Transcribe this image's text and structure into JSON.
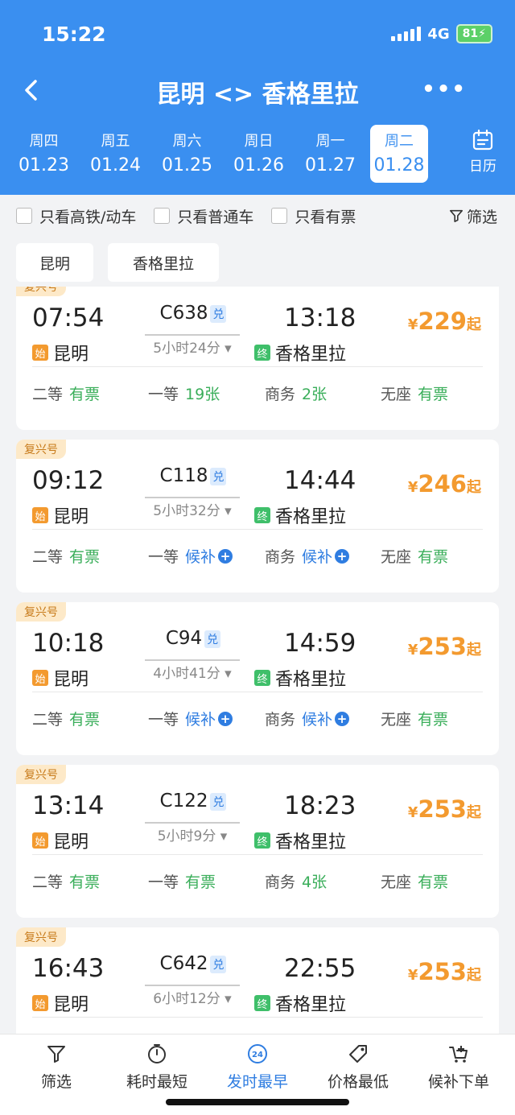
{
  "status": {
    "time": "15:22",
    "network": "4G",
    "battery": "81"
  },
  "nav": {
    "title": "昆明 <> 香格里拉",
    "more": "•••"
  },
  "dates": [
    {
      "weekday": "周四",
      "date": "01.23"
    },
    {
      "weekday": "周五",
      "date": "01.24"
    },
    {
      "weekday": "周六",
      "date": "01.25"
    },
    {
      "weekday": "周日",
      "date": "01.26"
    },
    {
      "weekday": "周一",
      "date": "01.27"
    },
    {
      "weekday": "周二",
      "date": "01.28"
    }
  ],
  "calendar_label": "日历",
  "filters": {
    "high_speed": "只看高铁/动车",
    "normal": "只看普通车",
    "available": "只看有票",
    "screen": "筛选"
  },
  "station_tags": {
    "from": "昆明",
    "to": "香格里拉"
  },
  "trains": [
    {
      "badge": "复兴号",
      "dep_time": "07:54",
      "train_no": "C638",
      "exchange": "兑",
      "arr_time": "13:18",
      "duration": "5小时24分",
      "dep_mark": "始",
      "from": "昆明",
      "arr_mark": "终",
      "to": "香格里拉",
      "currency": "¥",
      "price": "229",
      "price_suffix": "起",
      "seats": [
        {
          "name": "二等",
          "status": "有票"
        },
        {
          "name": "一等",
          "status": "19张"
        },
        {
          "name": "商务",
          "status": "2张"
        },
        {
          "name": "无座",
          "status": "有票"
        }
      ]
    },
    {
      "badge": "复兴号",
      "dep_time": "09:12",
      "train_no": "C118",
      "exchange": "兑",
      "arr_time": "14:44",
      "duration": "5小时32分",
      "dep_mark": "始",
      "from": "昆明",
      "arr_mark": "终",
      "to": "香格里拉",
      "currency": "¥",
      "price": "246",
      "price_suffix": "起",
      "seats": [
        {
          "name": "二等",
          "status": "有票"
        },
        {
          "name": "一等",
          "status": "候补"
        },
        {
          "name": "商务",
          "status": "候补"
        },
        {
          "name": "无座",
          "status": "有票"
        }
      ]
    },
    {
      "badge": "复兴号",
      "dep_time": "10:18",
      "train_no": "C94",
      "exchange": "兑",
      "arr_time": "14:59",
      "duration": "4小时41分",
      "dep_mark": "始",
      "from": "昆明",
      "arr_mark": "终",
      "to": "香格里拉",
      "currency": "¥",
      "price": "253",
      "price_suffix": "起",
      "seats": [
        {
          "name": "二等",
          "status": "有票"
        },
        {
          "name": "一等",
          "status": "候补"
        },
        {
          "name": "商务",
          "status": "候补"
        },
        {
          "name": "无座",
          "status": "有票"
        }
      ]
    },
    {
      "badge": "复兴号",
      "dep_time": "13:14",
      "train_no": "C122",
      "exchange": "兑",
      "arr_time": "18:23",
      "duration": "5小时9分",
      "dep_mark": "始",
      "from": "昆明",
      "arr_mark": "终",
      "to": "香格里拉",
      "currency": "¥",
      "price": "253",
      "price_suffix": "起",
      "seats": [
        {
          "name": "二等",
          "status": "有票"
        },
        {
          "name": "一等",
          "status": "有票"
        },
        {
          "name": "商务",
          "status": "4张"
        },
        {
          "name": "无座",
          "status": "有票"
        }
      ]
    },
    {
      "badge": "复兴号",
      "dep_time": "16:43",
      "train_no": "C642",
      "exchange": "兑",
      "arr_time": "22:55",
      "duration": "6小时12分",
      "dep_mark": "始",
      "from": "昆明",
      "arr_mark": "终",
      "to": "香格里拉",
      "currency": "¥",
      "price": "253",
      "price_suffix": "起",
      "seats": []
    }
  ],
  "tabbar": [
    {
      "label": "筛选",
      "icon": "filter-icon"
    },
    {
      "label": "耗时最短",
      "icon": "timer-icon"
    },
    {
      "label": "发时最早",
      "icon": "clock-24-icon",
      "icon_text": "24"
    },
    {
      "label": "价格最低",
      "icon": "price-tag-icon"
    },
    {
      "label": "候补下单",
      "icon": "cart-add-icon"
    }
  ],
  "colors": {
    "header": "#3a8ff0",
    "price": "#f39a2f",
    "available": "#3aae5a",
    "waitlist": "#2f7de1"
  }
}
